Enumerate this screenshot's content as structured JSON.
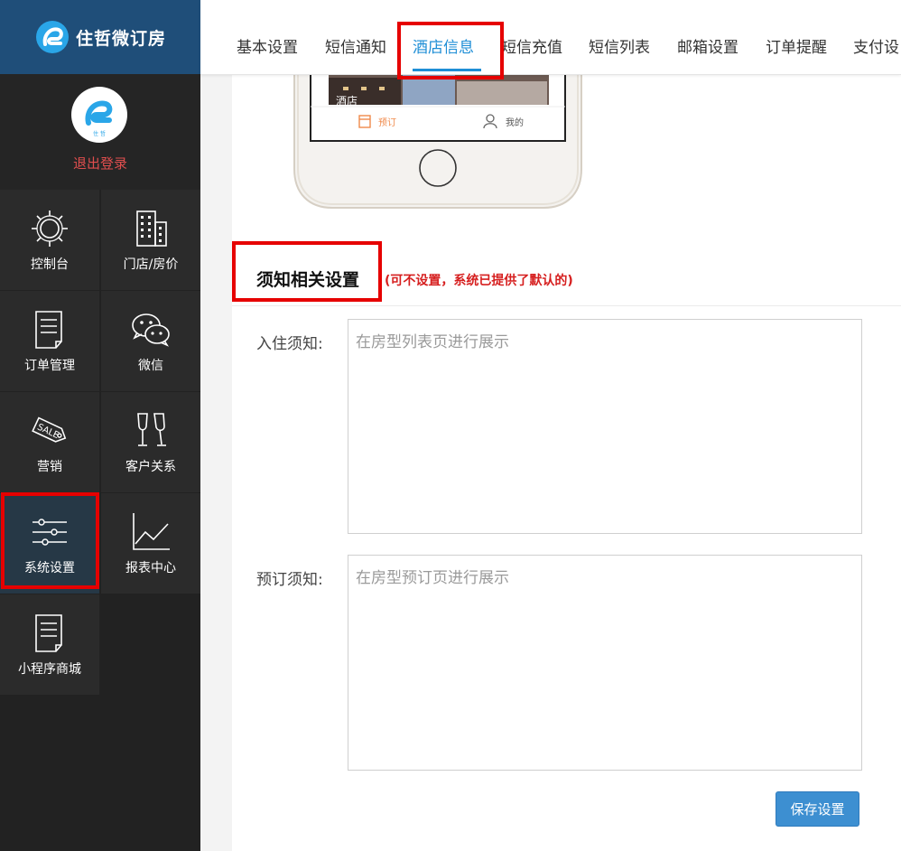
{
  "brand": {
    "name": "住哲微订房",
    "avatar_caption": "住 哲"
  },
  "sidebar": {
    "logout_label": "退出登录",
    "items": [
      {
        "label": "控制台",
        "icon": "gear-icon"
      },
      {
        "label": "门店/房价",
        "icon": "building-icon"
      },
      {
        "label": "订单管理",
        "icon": "document-icon"
      },
      {
        "label": "微信",
        "icon": "wechat-icon"
      },
      {
        "label": "营销",
        "icon": "sale-tag-icon"
      },
      {
        "label": "客户关系",
        "icon": "wine-glasses-icon"
      },
      {
        "label": "系统设置",
        "icon": "sliders-icon"
      },
      {
        "label": "报表中心",
        "icon": "line-chart-icon"
      },
      {
        "label": "小程序商城",
        "icon": "document-icon"
      }
    ]
  },
  "tabs": [
    {
      "label": "基本设置"
    },
    {
      "label": "短信通知"
    },
    {
      "label": "酒店信息"
    },
    {
      "label": "短信充值"
    },
    {
      "label": "短信列表"
    },
    {
      "label": "邮箱设置"
    },
    {
      "label": "订单提醒"
    },
    {
      "label": "支付设"
    }
  ],
  "phone": {
    "tab_book": "预订",
    "tab_me": "我的",
    "overlay_text": "酒店"
  },
  "section": {
    "title": "须知相关设置",
    "note": "(可不设置，系统已提供了默认的)"
  },
  "fields": {
    "checkin": {
      "label": "入住须知:",
      "placeholder": "在房型列表页进行展示",
      "value": ""
    },
    "booking": {
      "label": "预订须知:",
      "placeholder": "在房型预订页进行展示",
      "value": ""
    }
  },
  "buttons": {
    "save": "保存设置"
  },
  "colors": {
    "accent": "#1e8ed6",
    "highlight": "#e60000",
    "sidebar": "#222222",
    "brand_bar": "#1f4e79",
    "logout": "#e04e4e",
    "note": "#d61f1f"
  }
}
